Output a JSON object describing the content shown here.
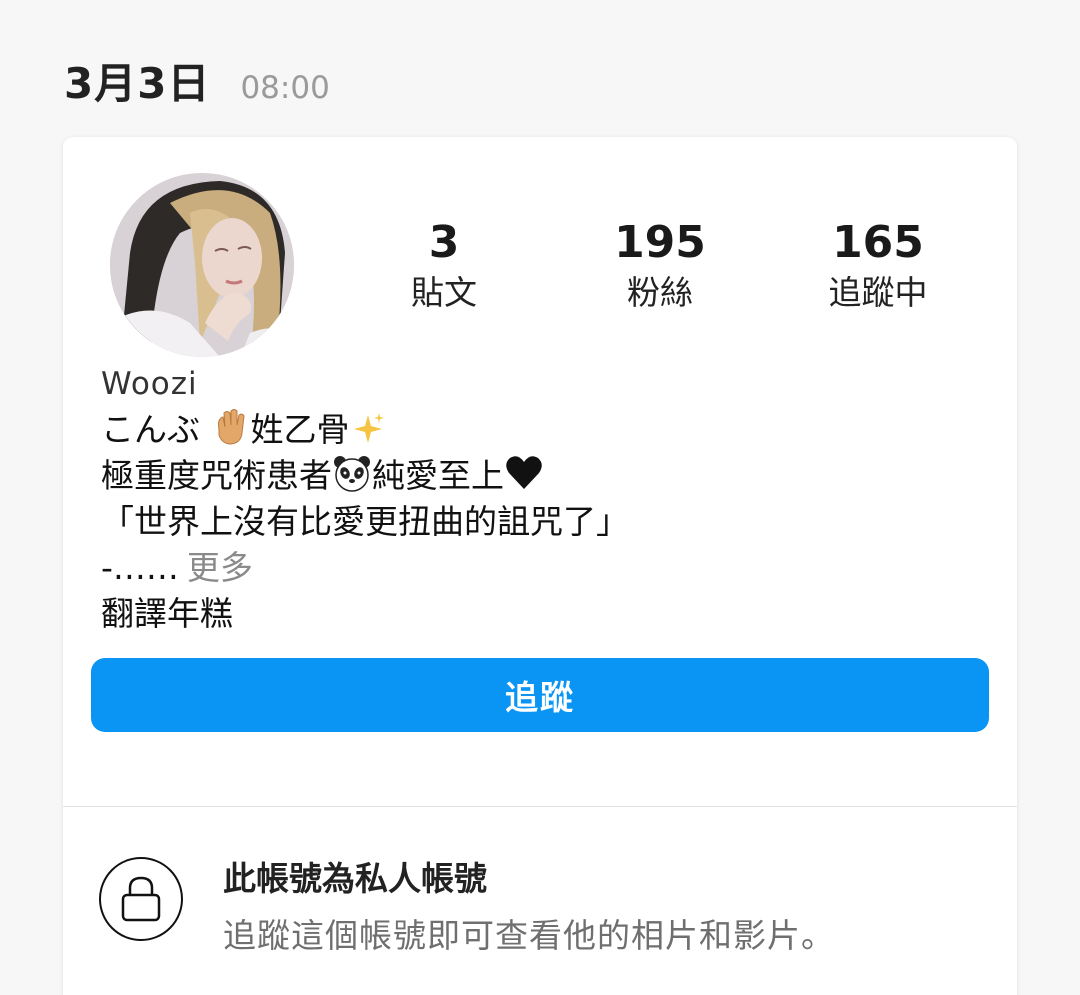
{
  "header": {
    "date": "3月3日",
    "time": "08:00"
  },
  "profile": {
    "avatar_icon": "avatar-portrait",
    "stats": {
      "posts_count": "3",
      "posts_label": "貼文",
      "followers_count": "195",
      "followers_label": "粉絲",
      "following_count": "165",
      "following_label": "追蹤中"
    },
    "name": "Woozi",
    "bio": {
      "line1_prefix": "こんぶ ",
      "line1_suffix": "姓乙骨",
      "line2_prefix": "極重度咒術患者",
      "line2_suffix": "純愛至上",
      "line3": "「世界上沒有比愛更扭曲的詛咒了」",
      "line4": "-……",
      "more": "更多",
      "line5": "翻譯年糕"
    },
    "bio_emojis": [
      "waving-hand-icon",
      "sparkles-icon",
      "panda-face-icon",
      "black-heart-icon"
    ],
    "follow_button": "追蹤"
  },
  "private_notice": {
    "icon": "lock-icon",
    "title": "此帳號為私人帳號",
    "description": "追蹤這個帳號即可查看他的相片和影片。"
  },
  "colors": {
    "accent": "#0a95f5",
    "background": "#f7f7f8",
    "muted_text": "#8a8a8a"
  }
}
